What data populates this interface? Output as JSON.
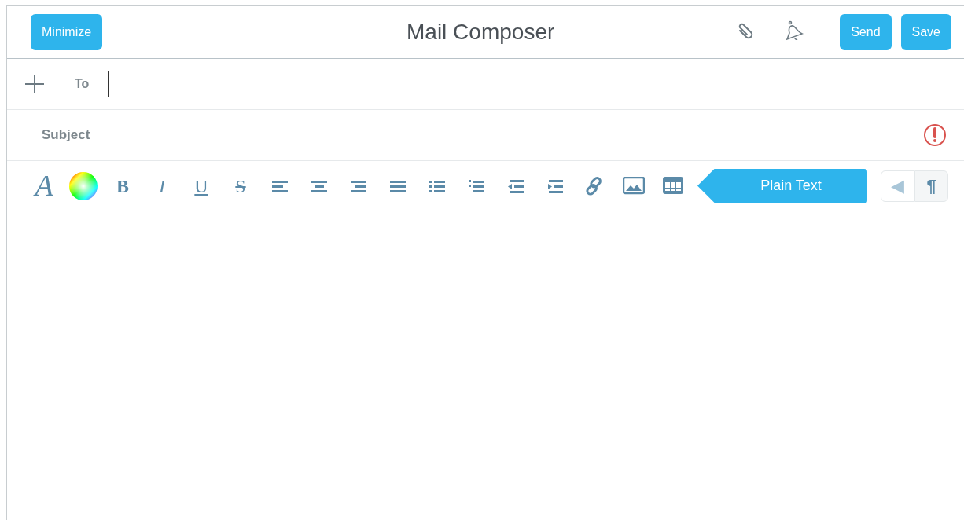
{
  "header": {
    "title": "Mail Composer",
    "left_buttons": [
      "Minimize"
    ],
    "right_buttons": [
      "Send",
      "Save"
    ]
  },
  "to_field": {
    "label": "To"
  },
  "subject_field": {
    "placeholder": "Subject",
    "important": true
  },
  "toolbar": [
    {
      "kind": "font",
      "text": "A"
    },
    {
      "kind": "color"
    },
    {
      "kind": "bold",
      "text": "B"
    },
    {
      "kind": "italic",
      "text": "I"
    },
    {
      "kind": "underline",
      "text": "U"
    },
    {
      "kind": "strike",
      "text": "S"
    },
    {
      "kind": "align-left"
    },
    {
      "kind": "align-center"
    },
    {
      "kind": "align-right"
    },
    {
      "kind": "justify"
    },
    {
      "kind": "bullets"
    },
    {
      "kind": "numbers"
    },
    {
      "kind": "outdent"
    },
    {
      "kind": "indent"
    },
    {
      "kind": "link"
    },
    {
      "kind": "image"
    },
    {
      "kind": "table"
    }
  ],
  "mode_label": "Plain Text",
  "direction_toggle": [
    {
      "text": "◀",
      "selected": false
    },
    {
      "text": "¶",
      "selected": true
    }
  ]
}
